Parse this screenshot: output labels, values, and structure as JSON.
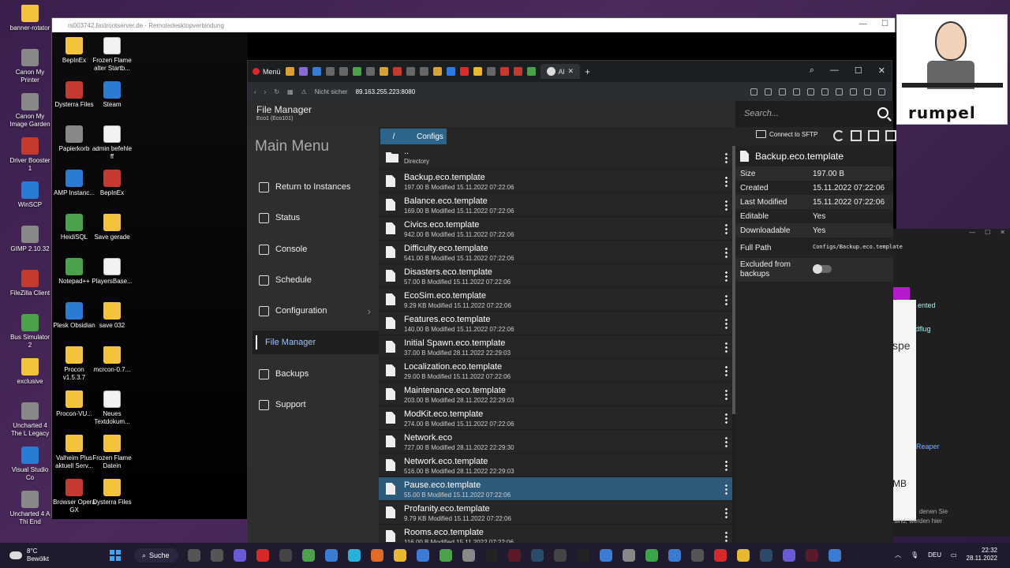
{
  "desktop_icons": [
    {
      "label": "banner-rotator",
      "kind": "folder"
    },
    {
      "label": "Canon My Printer",
      "kind": "app4"
    },
    {
      "label": "Canon My Image Garden",
      "kind": "app4"
    },
    {
      "label": "Driver Booster 1",
      "kind": "app2"
    },
    {
      "label": "WinSCP",
      "kind": "app1"
    },
    {
      "label": "GIMP 2.10.32",
      "kind": "app4"
    },
    {
      "label": "FileZilla Client",
      "kind": "app2"
    },
    {
      "label": "Bus Simulator 2",
      "kind": "app3"
    },
    {
      "label": "exclusive",
      "kind": "folder"
    },
    {
      "label": "Uncharted 4 The L Legacy",
      "kind": "app4"
    },
    {
      "label": "Visual Studio Co",
      "kind": "app1"
    },
    {
      "label": "Uncharted 4 A Thi End",
      "kind": "app4"
    }
  ],
  "rdp_icons": [
    {
      "label": "BepInEx",
      "kind": "folder"
    },
    {
      "label": "Frozen Flame alter Startb...",
      "kind": "file"
    },
    {
      "label": "Dysterra Files",
      "kind": "app2"
    },
    {
      "label": "Steam",
      "kind": "app1"
    },
    {
      "label": "Papierkorb",
      "kind": "app4"
    },
    {
      "label": "admin befehle ff",
      "kind": "file"
    },
    {
      "label": "AMP Instanc...",
      "kind": "app1"
    },
    {
      "label": "BepInEx",
      "kind": "app2"
    },
    {
      "label": "HeidiSQL",
      "kind": "app3"
    },
    {
      "label": "Save gerade",
      "kind": "folder"
    },
    {
      "label": "Notepad++",
      "kind": "app3"
    },
    {
      "label": "PlayersBase...",
      "kind": "file"
    },
    {
      "label": "Plesk Obsidian",
      "kind": "app1"
    },
    {
      "label": "save 032",
      "kind": "folder"
    },
    {
      "label": "Procon v1.5.3.7",
      "kind": "folder"
    },
    {
      "label": "mcrcon-0.7...",
      "kind": "folder"
    },
    {
      "label": "Procon-VU...",
      "kind": "folder"
    },
    {
      "label": "Neues Textdokum...",
      "kind": "file"
    },
    {
      "label": "Valheim Plus aktuell Serv...",
      "kind": "folder"
    },
    {
      "label": "Frozen Flame Datein",
      "kind": "folder"
    },
    {
      "label": "Browser Opera GX",
      "kind": "app2"
    },
    {
      "label": "Dysterra Files",
      "kind": "folder"
    }
  ],
  "rdp": {
    "title": "rs003742.fastrootserver.de - Remotedesktopverbindung"
  },
  "browser": {
    "menu_label": "Menü",
    "active_tab": "Al",
    "address_insecure": "Nicht sicher",
    "address_url": "89.163.255.223:8080"
  },
  "app": {
    "title": "File Manager",
    "subtitle": "Eco1 (Eco101)",
    "search_placeholder": "Search...",
    "menu_title": "Main Menu",
    "nav": [
      {
        "label": "Return to Instances",
        "icon": "return-icon"
      },
      {
        "label": "Status",
        "icon": "status-icon"
      },
      {
        "label": "Console",
        "icon": "console-icon"
      },
      {
        "label": "Schedule",
        "icon": "schedule-icon"
      },
      {
        "label": "Configuration",
        "icon": "gear-icon"
      },
      {
        "label": "File Manager",
        "icon": "file-icon"
      },
      {
        "label": "Backups",
        "icon": "database-icon"
      },
      {
        "label": "Support",
        "icon": "support-icon"
      }
    ],
    "breadcrumb_root": "/",
    "breadcrumb_current": "Configs",
    "sftp_label": "Connect to SFTP",
    "files": [
      {
        "name": "..",
        "meta": "Directory",
        "dir": true
      },
      {
        "name": "Backup.eco.template",
        "meta": "197.00 B Modified 15.11.2022 07:22:06"
      },
      {
        "name": "Balance.eco.template",
        "meta": "169.00 B Modified 15.11.2022 07:22:06"
      },
      {
        "name": "Civics.eco.template",
        "meta": "942.00 B Modified 15.11.2022 07:22:06"
      },
      {
        "name": "Difficulty.eco.template",
        "meta": "541.00 B Modified 15.11.2022 07:22:06"
      },
      {
        "name": "Disasters.eco.template",
        "meta": "57.00 B Modified 15.11.2022 07:22:06"
      },
      {
        "name": "EcoSim.eco.template",
        "meta": "9.29 KB Modified 15.11.2022 07:22:06"
      },
      {
        "name": "Features.eco.template",
        "meta": "140.00 B Modified 15.11.2022 07:22:06"
      },
      {
        "name": "Initial Spawn.eco.template",
        "meta": "37.00 B Modified 28.11.2022 22:29:03"
      },
      {
        "name": "Localization.eco.template",
        "meta": "29.00 B Modified 15.11.2022 07:22:06"
      },
      {
        "name": "Maintenance.eco.template",
        "meta": "203.00 B Modified 28.11.2022 22:29:03"
      },
      {
        "name": "ModKit.eco.template",
        "meta": "274.00 B Modified 15.11.2022 07:22:06"
      },
      {
        "name": "Network.eco",
        "meta": "727.00 B Modified 28.11.2022 22:29:30"
      },
      {
        "name": "Network.eco.template",
        "meta": "516.00 B Modified 28.11.2022 22:29:03"
      },
      {
        "name": "Pause.eco.template",
        "meta": "55.00 B Modified 15.11.2022 07:22:06",
        "selected": true
      },
      {
        "name": "Profanity.eco.template",
        "meta": "9.79 KB Modified 15.11.2022 07:22:06"
      },
      {
        "name": "Rooms.eco.template",
        "meta": "116.00 B Modified 15.11.2022 07:22:06"
      }
    ],
    "details": {
      "filename": "Backup.eco.template",
      "rows": [
        {
          "k": "Size",
          "v": "197.00 B"
        },
        {
          "k": "Created",
          "v": "15.11.2022 07:22:06"
        },
        {
          "k": "Last Modified",
          "v": "15.11.2022 07:22:06"
        },
        {
          "k": "Editable",
          "v": "Yes"
        },
        {
          "k": "Downloadable",
          "v": "Yes"
        }
      ],
      "full_path_label": "Full Path",
      "full_path": "Configs/Backup.eco.template",
      "excluded_label": "Excluded from backups"
    }
  },
  "side_window": {
    "texts": [
      "ented",
      "dflug",
      "spe",
      "Reaper",
      "MB",
      "denen Sie",
      "sind, werden hier"
    ]
  },
  "webcam": {
    "name": "rumpel"
  },
  "taskbar": {
    "weather_temp": "8°C",
    "weather_desc": "Bewölkt",
    "search_label": "Suche",
    "lang": "DEU",
    "time": "22:32",
    "date": "28.11.2022"
  }
}
